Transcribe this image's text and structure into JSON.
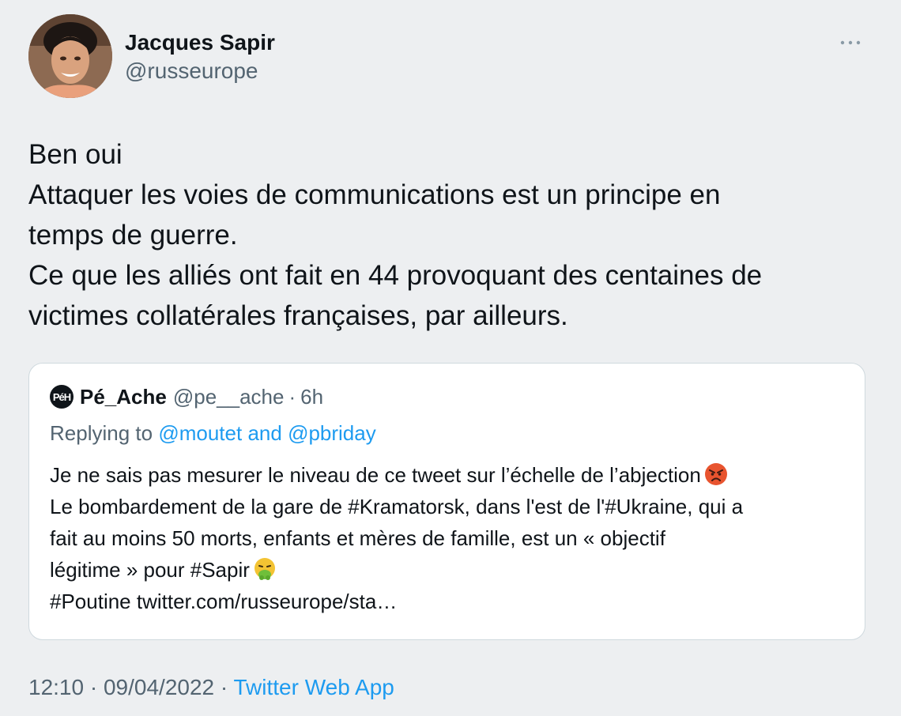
{
  "tweet": {
    "author": {
      "name": "Jacques Sapir",
      "handle": "@russeurope"
    },
    "text_lines": [
      "Ben oui",
      "Attaquer les voies de communications est un principe en",
      "temps de guerre.",
      "Ce que les alliés ont fait en 44 provoquant des centaines de",
      "victimes collatérales françaises, par ailleurs."
    ],
    "quoted": {
      "avatar_text": "PéH",
      "name": "Pé_Ache",
      "handle": "@pe__ache",
      "separator": "·",
      "time": "6h",
      "replying_prefix": "Replying to",
      "mention_1": "@moutet",
      "and_word": "and",
      "mention_2": "@pbriday",
      "text_lines": [
        "Je ne sais pas mesurer le niveau de ce tweet sur l’échelle de l’abjection",
        "Le bombardement de la gare de #Kramatorsk, dans l'est de l'#Ukraine, qui a",
        "fait au moins 50 morts, enfants et mères de famille, est un « objectif",
        "légitime » pour #Sapir",
        "#Poutine twitter.com/russeurope/sta…"
      ],
      "emoji_1": "angry-face-emoji",
      "emoji_2": "vomiting-face-emoji"
    },
    "footer": {
      "time": "12:10",
      "date": "09/04/2022",
      "separator": "·",
      "app": "Twitter Web App"
    }
  },
  "colors": {
    "background": "#edeff1",
    "text": "#0f1419",
    "secondary": "#536471",
    "link": "#1d9bf0",
    "border": "#cfd9de"
  }
}
